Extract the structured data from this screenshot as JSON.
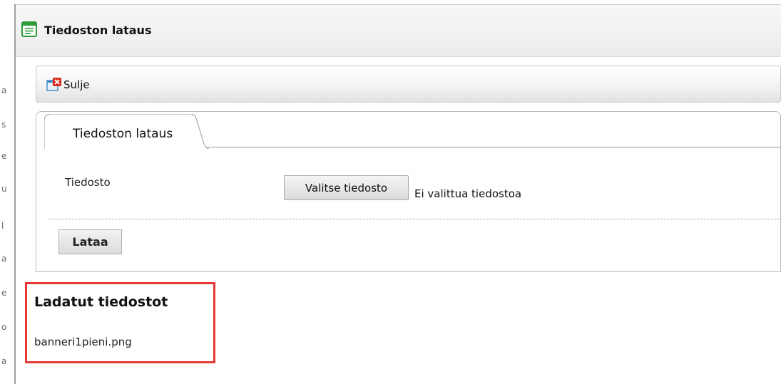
{
  "window": {
    "title": "Tiedoston lataus",
    "icon": "form-window-icon"
  },
  "toolbar": {
    "close_label": "Sulje",
    "close_icon": "window-close-icon"
  },
  "tabs": [
    {
      "label": "Tiedoston lataus",
      "active": true
    }
  ],
  "form": {
    "file_label": "Tiedosto",
    "choose_file_button": "Valitse tiedosto",
    "no_file_selected": "Ei valittua tiedostoa",
    "upload_button": "Lataa"
  },
  "uploaded": {
    "heading": "Ladatut tiedostot",
    "files": [
      "banneri1pieni.png"
    ]
  },
  "colors": {
    "highlight_border": "#e53935",
    "icon_green": "#2e9b3a",
    "close_red": "#d9281c"
  }
}
